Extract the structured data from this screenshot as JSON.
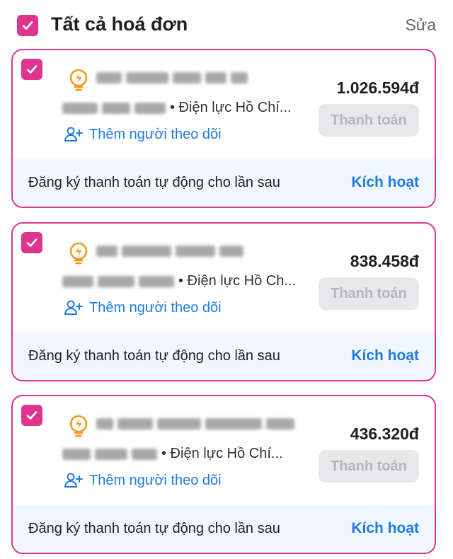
{
  "header": {
    "title": "Tất cả hoá đơn",
    "edit_label": "Sửa",
    "select_all_checked": true
  },
  "bills": [
    {
      "checked": true,
      "icon": "lightning-bulb-icon",
      "meta_text": "• Điện lực Hồ Chí...",
      "follow_label": "Thêm người theo dõi",
      "amount": "1.026.594đ",
      "pay_label": "Thanh toán",
      "autopay_text": "Đăng ký thanh toán tự động cho lần sau",
      "activate_label": "Kích hoạt"
    },
    {
      "checked": true,
      "icon": "lightning-bulb-icon",
      "meta_text": "• Điện lực Hồ Ch...",
      "follow_label": "Thêm người theo dõi",
      "amount": "838.458đ",
      "pay_label": "Thanh toán",
      "autopay_text": "Đăng ký thanh toán tự động cho lần sau",
      "activate_label": "Kích hoạt"
    },
    {
      "checked": true,
      "icon": "lightning-bulb-icon",
      "meta_text": "• Điện lực Hồ Chí...",
      "follow_label": "Thêm người theo dõi",
      "amount": "436.320đ",
      "pay_label": "Thanh toán",
      "autopay_text": "Đăng ký thanh toán tự động cho lần sau",
      "activate_label": "Kích hoạt"
    }
  ],
  "colors": {
    "accent": "#e0358f",
    "link": "#1f7be0",
    "autopay_bg": "#f1f7ff",
    "bolt": "#f39a1e"
  }
}
